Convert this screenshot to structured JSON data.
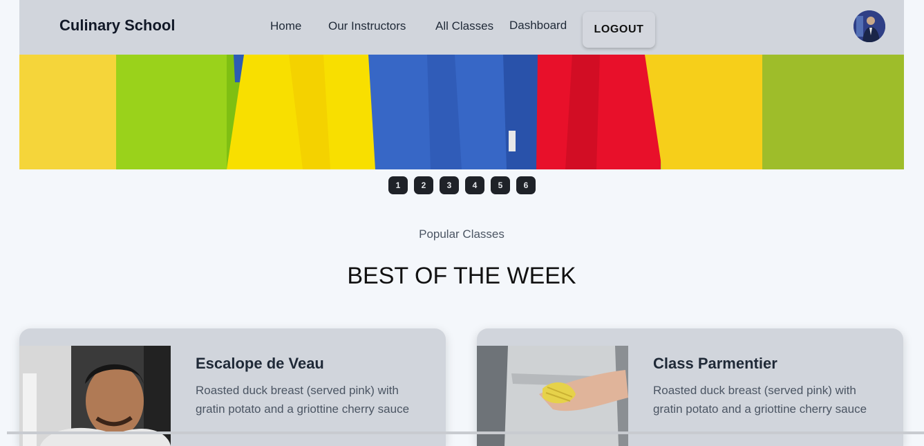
{
  "navbar": {
    "brand": "Culinary School",
    "links": [
      "Home",
      "Our Instructors",
      "All Classes",
      "Dashboard"
    ],
    "logout_label": "LOGOUT"
  },
  "carousel": {
    "slides": [
      "1",
      "2",
      "3",
      "4",
      "5",
      "6"
    ]
  },
  "section": {
    "subtitle": "Popular Classes",
    "title": "BEST OF THE WEEK"
  },
  "cards": [
    {
      "title": "Escalope de Veau",
      "description": "Roasted duck breast (served pink) with gratin potato and a griottine cherry sauce"
    },
    {
      "title": "Class Parmentier",
      "description": "Roasted duck breast (served pink) with gratin potato and a griottine cherry sauce"
    }
  ],
  "colors": {
    "navbar_bg": "#d1d5dc",
    "page_bg": "#f4f7fb",
    "dot_bg": "#1f2228"
  }
}
